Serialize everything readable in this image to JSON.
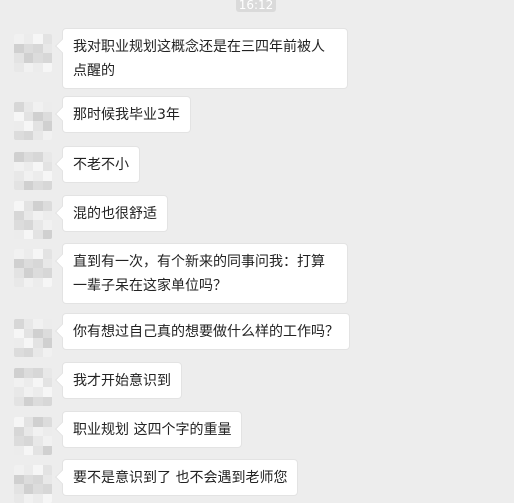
{
  "status": {
    "time": "16:12"
  },
  "colors": {
    "background": "#ededed",
    "bubble": "#ffffff",
    "text": "#222222"
  },
  "messages": [
    {
      "text": "我对职业规划这概念还是在三四年前被人点醒的"
    },
    {
      "text": "那时候我毕业3年"
    },
    {
      "text": "不老不小"
    },
    {
      "text": "混的也很舒适"
    },
    {
      "text": "直到有一次，有个新来的同事问我：打算一辈子呆在这家单位吗？"
    },
    {
      "text": "你有想过自己真的想要做什么样的工作吗？"
    },
    {
      "text": "我才开始意识到"
    },
    {
      "text": "职业规划 这四个字的重量"
    },
    {
      "text": "要不是意识到了 也不会遇到老师您"
    }
  ]
}
